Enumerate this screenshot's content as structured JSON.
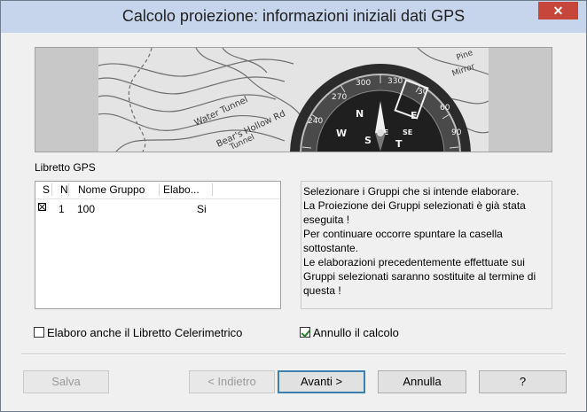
{
  "window": {
    "title": "Calcolo proiezione: informazioni iniziali dati GPS",
    "close_glyph": "✕"
  },
  "banner": {
    "map_labels": [
      "Water Tunnel",
      "Bear's Hollow Rd",
      "Tunnel",
      "Pine",
      "Mirror"
    ],
    "compass_numbers": [
      "270",
      "300",
      "330",
      "240",
      "30",
      "60",
      "90"
    ],
    "compass_letters": [
      "N",
      "E",
      "S",
      "W",
      "T",
      "NE",
      "SE"
    ]
  },
  "section_label": "Libretto GPS",
  "list": {
    "columns": [
      "S",
      "N",
      "Nome Gruppo",
      "Elabo..."
    ],
    "rows": [
      {
        "selected": true,
        "n": "1",
        "nome": "100",
        "elabo": "Si"
      }
    ]
  },
  "info_text": [
    "Selezionare i Gruppi che si intende elaborare.",
    "La Proiezione dei Gruppi selezionati è già stata eseguita !",
    "Per continuare occorre spuntare la casella sottostante.",
    "Le elaborazioni precedentemente effettuate sui Gruppi selezionati saranno sostituite al termine di questa !"
  ],
  "options": {
    "elaboro_label": "Elaboro anche il Libretto Celerimetrico",
    "elaboro_checked": false,
    "annullo_label": "Annullo il calcolo",
    "annullo_checked": true
  },
  "buttons": {
    "salva": "Salva",
    "indietro": "< Indietro",
    "avanti": "Avanti >",
    "annulla": "Annulla",
    "help": "?"
  }
}
